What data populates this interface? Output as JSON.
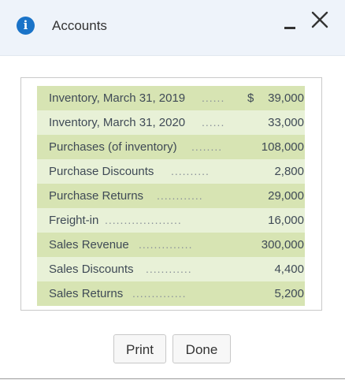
{
  "dialog": {
    "title": "Accounts",
    "info_icon_glyph": "i",
    "icons": {
      "info": "info-icon",
      "minimize": "minimize-icon",
      "close": "close-icon"
    }
  },
  "accounts": {
    "currency_symbol": "$",
    "rows": [
      {
        "label": "Inventory, March 31, 2019",
        "dots": "......",
        "amount": "39,000",
        "show_currency": true
      },
      {
        "label": "Inventory, March 31, 2020",
        "dots": "......",
        "amount": "33,000",
        "show_currency": false
      },
      {
        "label": "Purchases (of inventory)",
        "dots": "........",
        "amount": "108,000",
        "show_currency": false
      },
      {
        "label": "Purchase Discounts",
        "dots": "..........",
        "amount": "2,800",
        "show_currency": false
      },
      {
        "label": "Purchase Returns",
        "dots": "............",
        "amount": "29,000",
        "show_currency": false
      },
      {
        "label": "Freight-in",
        "dots": "....................",
        "amount": "16,000",
        "show_currency": false
      },
      {
        "label": "Sales Revenue",
        "dots": "..............",
        "amount": "300,000",
        "show_currency": false
      },
      {
        "label": "Sales Discounts",
        "dots": "............",
        "amount": "4,400",
        "show_currency": false
      },
      {
        "label": "Sales Returns",
        "dots": "..............",
        "amount": "5,200",
        "show_currency": false
      }
    ]
  },
  "buttons": {
    "print": "Print",
    "done": "Done"
  }
}
